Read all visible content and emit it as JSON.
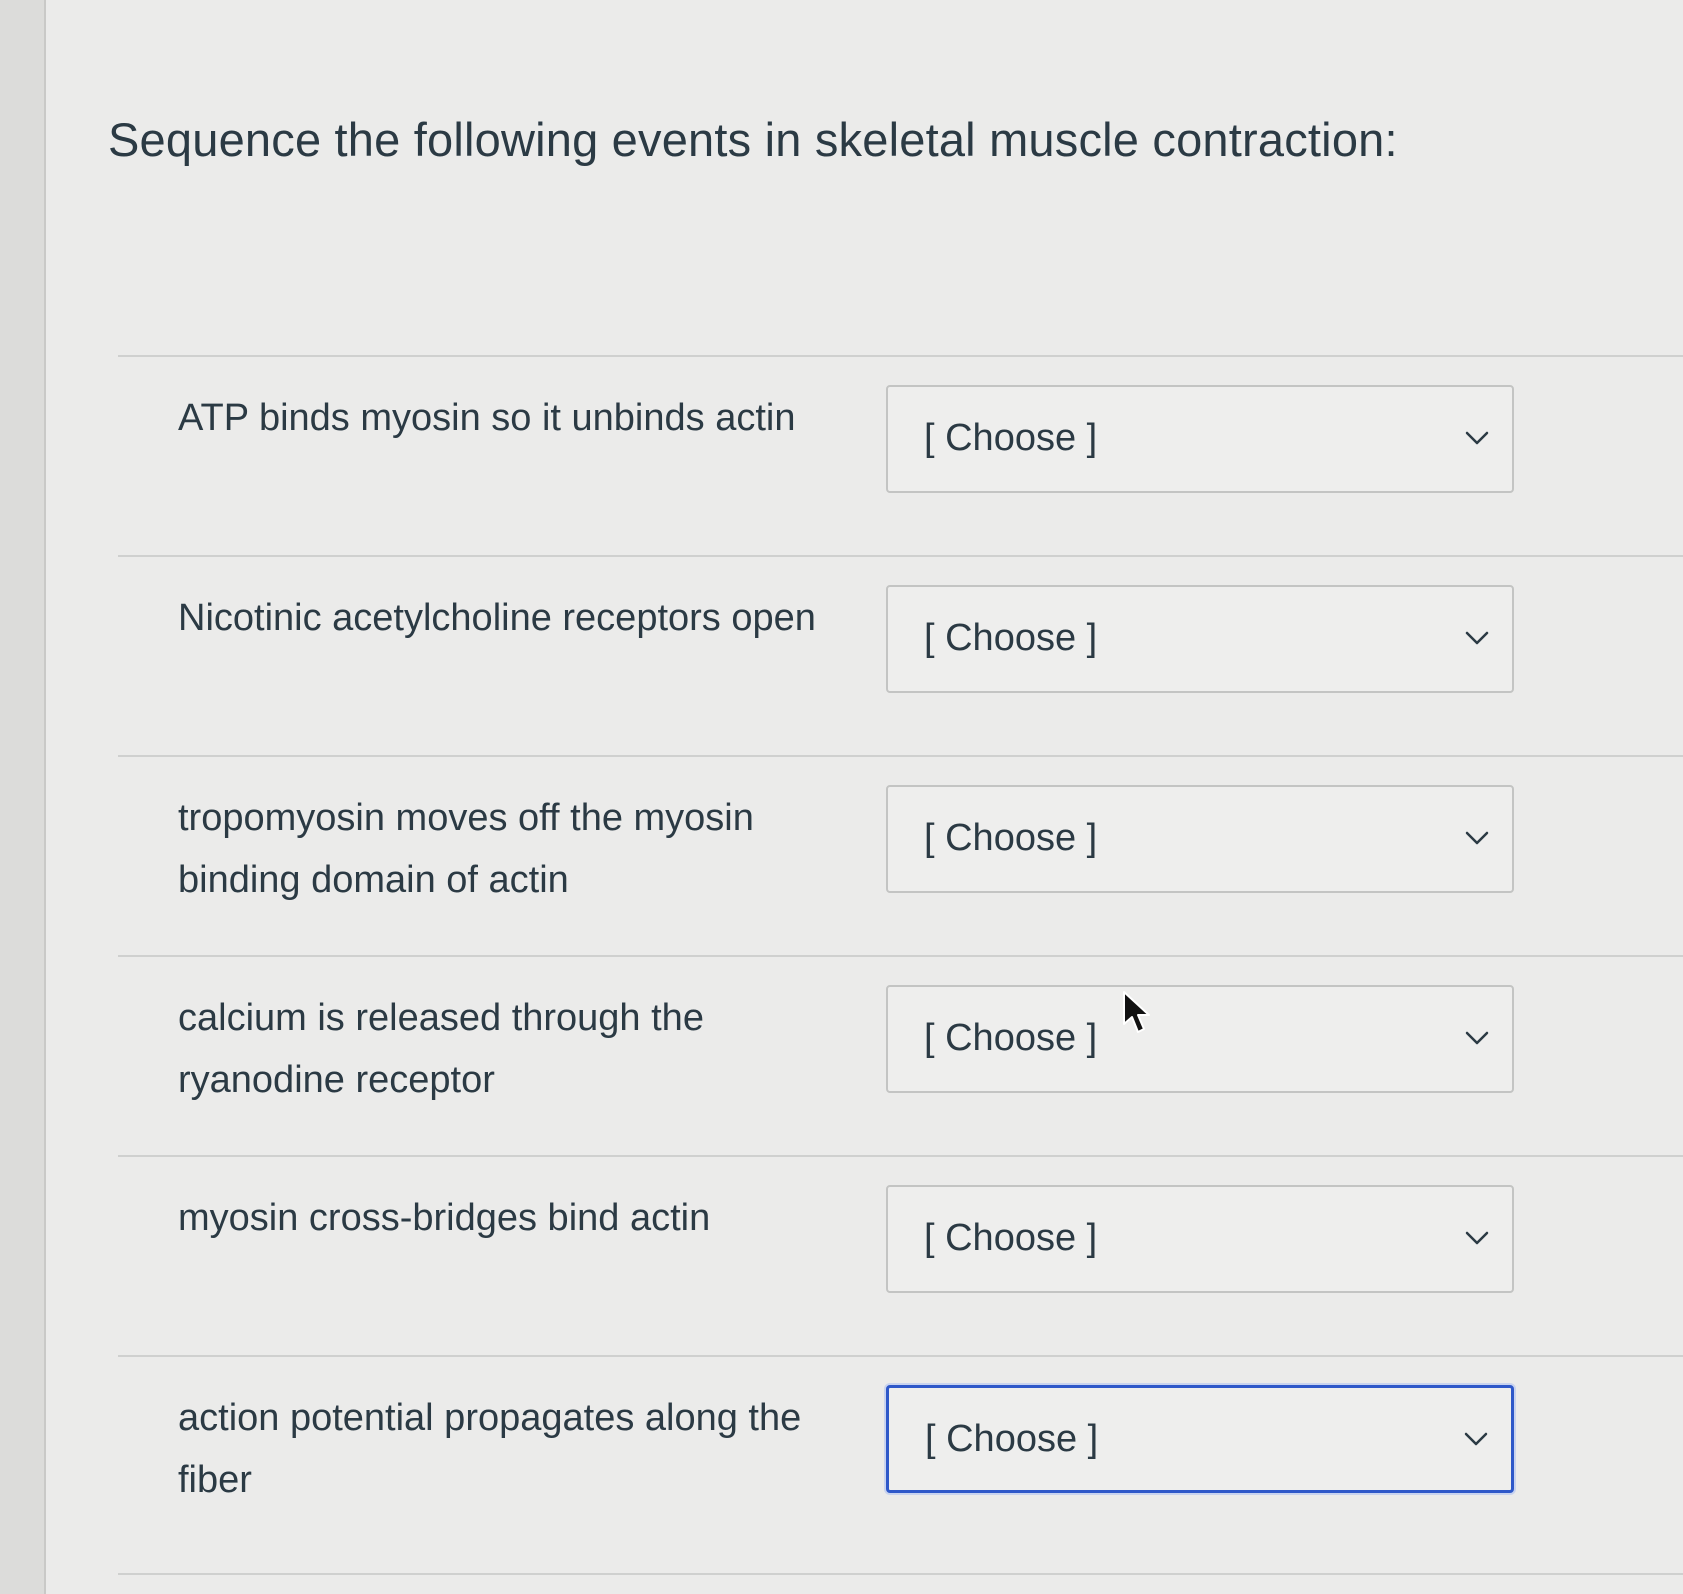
{
  "question": {
    "title": "Sequence the following events in skeletal muscle contraction:"
  },
  "rows": [
    {
      "label": "ATP binds myosin so it unbinds actin",
      "selected": "[ Choose ]"
    },
    {
      "label": "Nicotinic acetylcholine receptors open",
      "selected": "[ Choose ]"
    },
    {
      "label": "tropomyosin moves off the myosin binding domain of actin",
      "selected": "[ Choose ]"
    },
    {
      "label": "calcium is released through the ryanodine receptor",
      "selected": "[ Choose ]"
    },
    {
      "label": "myosin cross-bridges bind actin",
      "selected": "[ Choose ]"
    },
    {
      "label": "action potential propagates along the fiber",
      "selected": "[ Choose ]"
    }
  ],
  "colors": {
    "focus_border": "#2e58c9",
    "text": "#2b3a44",
    "background": "#ebebea"
  },
  "icons": {
    "select_chevron": "chevron-down-icon",
    "mouse_pointer": "cursor-arrow-icon"
  }
}
